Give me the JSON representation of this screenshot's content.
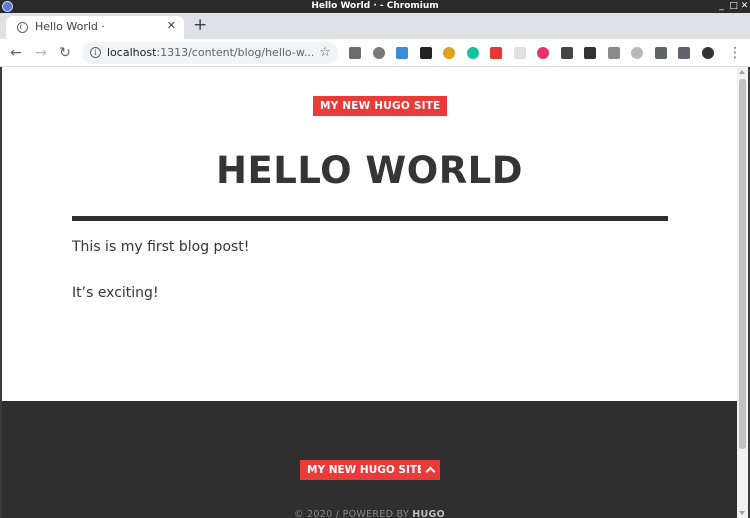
{
  "window": {
    "title": "Hello World · - Chromium"
  },
  "browser": {
    "tab_title": "Hello World ·",
    "tab_close": "✕",
    "new_tab": "+",
    "url_host": "localhost",
    "url_rest": ":1313/content/blog/hello-w...",
    "extensions": [
      {
        "name": "recycle-extension-icon",
        "color": "#6d6d6d"
      },
      {
        "name": "circle-extension-icon",
        "color": "#7a7a7a"
      },
      {
        "name": "hi-extension-icon",
        "color": "#3d8bd6"
      },
      {
        "name": "buffer-extension-icon",
        "color": "#222222"
      },
      {
        "name": "color-wheel-extension-icon",
        "color": "#e0a020"
      },
      {
        "name": "grammarly-extension-icon",
        "color": "#15c39a"
      },
      {
        "name": "youtube-extension-icon",
        "color": "#e53935"
      },
      {
        "name": "blank-extension-icon",
        "color": "#e0e0e0"
      },
      {
        "name": "record-extension-icon",
        "color": "#e8336a"
      },
      {
        "name": "rocket-extension-icon",
        "color": "#444444"
      },
      {
        "name": "m-extension-icon",
        "color": "#333333"
      },
      {
        "name": "vue-extension-icon",
        "color": "#8a8a8a"
      },
      {
        "name": "circle-grey-extension-icon",
        "color": "#b9b9b9"
      },
      {
        "name": "puzzle-extension-icon",
        "color": "#5f6368"
      },
      {
        "name": "playlist-extension-icon",
        "color": "#5f6368"
      },
      {
        "name": "profile-avatar-icon",
        "color": "#333333"
      }
    ]
  },
  "page": {
    "site_title": "MY NEW HUGO SITE",
    "post_title": "HELLO WORLD",
    "paragraphs": [
      "This is my first blog post!",
      "It’s exciting!"
    ],
    "footer": {
      "site_title": "MY NEW HUGO SITE",
      "copyright_prefix": "© 2020 / POWERED BY ",
      "copyright_brand": "HUGO"
    }
  },
  "colors": {
    "accent": "#ea3a3a",
    "footer_bg": "#2f2f2f",
    "text": "#353535"
  }
}
